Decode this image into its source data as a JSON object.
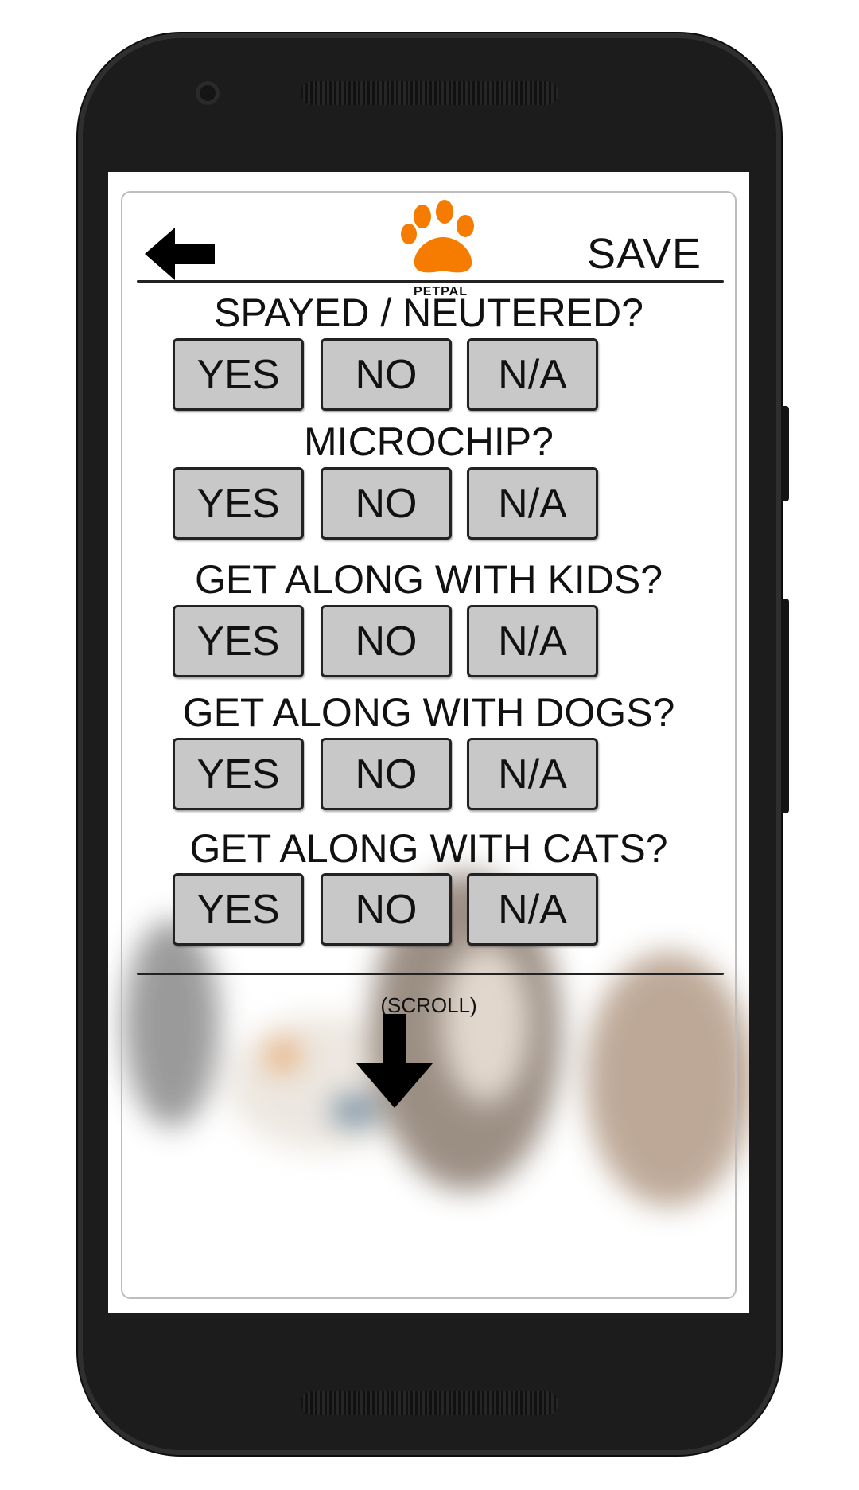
{
  "header": {
    "app_logo_text": "PETPAL",
    "save_label": "SAVE"
  },
  "questions": [
    {
      "label": "SPAYED / NEUTERED?",
      "options": [
        "YES",
        "NO",
        "N/A"
      ]
    },
    {
      "label": "MICROCHIP?",
      "options": [
        "YES",
        "NO",
        "N/A"
      ]
    },
    {
      "label": "GET ALONG WITH KIDS?",
      "options": [
        "YES",
        "NO",
        "N/A"
      ]
    },
    {
      "label": "GET ALONG WITH DOGS?",
      "options": [
        "YES",
        "NO",
        "N/A"
      ]
    },
    {
      "label": "GET ALONG WITH CATS?",
      "options": [
        "YES",
        "NO",
        "N/A"
      ]
    }
  ],
  "footer": {
    "scroll_label": "(SCROLL)"
  },
  "colors": {
    "brand_orange": "#f57c00",
    "button_fill": "#c8c8c8",
    "phone_body": "#1c1c1c"
  }
}
